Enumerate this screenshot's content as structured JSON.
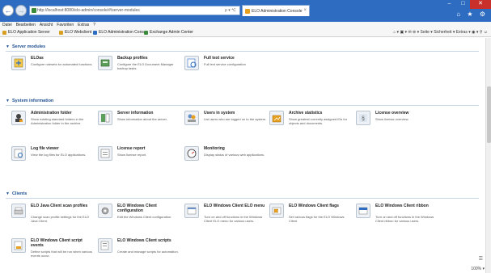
{
  "browser": {
    "url": "http://localhost:8080/elo-admin/console/#/server-modules",
    "address_tools": "ρ ▾ ℃",
    "tab_title": "ELO Administration Console",
    "tab_close": "×",
    "min": "–",
    "max": "□",
    "close": "✕",
    "chrome_icons": "⌂ ★ ⚙",
    "menu": [
      "Datei",
      "Bearbeiten",
      "Ansicht",
      "Favoriten",
      "Extras",
      "?"
    ],
    "favorites": [
      {
        "label": "ELO Application Server",
        "color": "#d8a020"
      },
      {
        "label": "ELO Webclient",
        "color": "#d8a020"
      },
      {
        "label": "ELO Administration Cons...",
        "color": "#2d6cc0"
      },
      {
        "label": "Exchange Admin Center",
        "color": "#3a8c3a"
      }
    ],
    "cmdbar": "⌂ ▾  ▣ ▾  ✉  ⊜ ▾  Seite ▾  Sicherheit ▾  Extras ▾  ◉ ▾  ⚲  ☺",
    "zoom": "100% ▾",
    "ie_mini": "☰"
  },
  "sections": [
    {
      "title": "Server modules",
      "tiles": [
        {
          "title": "ELOas",
          "desc": "Configure rulesets for automated functions.",
          "icon": "eloas-icon"
        },
        {
          "title": "Backup profiles",
          "desc": "Configure the ELO Document Manager backup tasks.",
          "icon": "backup-profiles-icon"
        },
        {
          "title": "Full text service",
          "desc": "Full text service configuration",
          "icon": "fulltext-service-icon"
        }
      ]
    },
    {
      "title": "System information",
      "tiles": [
        {
          "title": "Administration folder",
          "desc": "Show existing standard folders in the Administration folder in the archive.",
          "icon": "administration-folder-icon"
        },
        {
          "title": "Server information",
          "desc": "Show information about the server.",
          "icon": "server-information-icon"
        },
        {
          "title": "Users in system",
          "desc": "List users who are logged on to the system.",
          "icon": "users-in-system-icon"
        },
        {
          "title": "Archive statistics",
          "desc": "Show greatest currently assigned IDs for objects and documents.",
          "icon": "archive-statistics-icon"
        },
        {
          "title": "License overview",
          "desc": "Show license overview.",
          "icon": "license-overview-icon"
        },
        {
          "title": "Log file viewer",
          "desc": "View the log files for ELO applications.",
          "icon": "log-file-viewer-icon"
        },
        {
          "title": "License report",
          "desc": "Show license report.",
          "icon": "license-report-icon"
        },
        {
          "title": "Monitoring",
          "desc": "Display status of various web applications.",
          "icon": "monitoring-icon"
        }
      ]
    },
    {
      "title": "Clients",
      "tiles": [
        {
          "title": "ELO Java Client scan profiles",
          "desc": "Change scan profile settings for the ELO Java Client.",
          "icon": "scan-profiles-icon"
        },
        {
          "title": "ELO Windows Client configuration",
          "desc": "Edit the Windows Client configuration.",
          "icon": "client-configuration-icon"
        },
        {
          "title": "ELO Windows Client ELO menu",
          "desc": "Turn on and off functions in the Windows Client ELO menu for various users.",
          "icon": "client-elo-menu-icon"
        },
        {
          "title": "ELO Windows Client flags",
          "desc": "Set various flags for the ELO Windows Client",
          "icon": "client-flags-icon"
        },
        {
          "title": "ELO Windows Client ribbon",
          "desc": "Turn on and off functions in the Windows Client ribbon for various users.",
          "icon": "client-ribbon-icon"
        },
        {
          "title": "ELO Windows Client script events",
          "desc": "Define scripts that will be run when various events occur.",
          "icon": "script-events-icon"
        },
        {
          "title": "ELO Windows Client scripts",
          "desc": "Create and manage scripts for automation.",
          "icon": "client-scripts-icon"
        }
      ]
    }
  ]
}
